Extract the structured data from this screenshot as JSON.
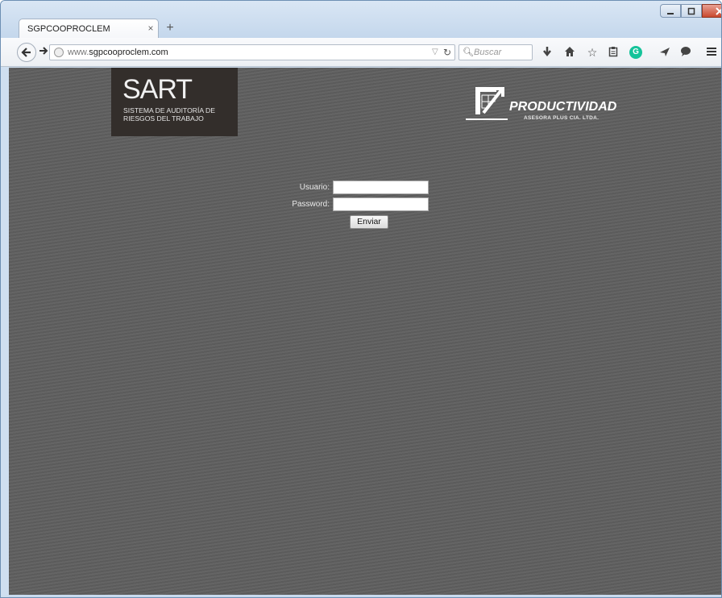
{
  "browser": {
    "tab_title": "SGPCOOPROCLEM",
    "tab_close": "×",
    "new_tab": "+",
    "url_prefix": "www.",
    "url_domain": "sgpcooproclem.com",
    "search_placeholder": "Buscar",
    "icons": {
      "back": "back-arrow-icon",
      "forward": "forward-arrow-icon",
      "globe": "globe-icon",
      "reload": "reload-icon",
      "search": "search-icon",
      "download": "download-icon",
      "home": "home-icon",
      "bookmark": "star-icon",
      "reading_list": "clipboard-icon",
      "grammarly": "grammarly-icon",
      "send": "send-icon",
      "chat": "chat-icon",
      "menu": "hamburger-menu-icon"
    },
    "window_controls": [
      "minimize",
      "maximize",
      "close"
    ]
  },
  "page": {
    "background_color": "#5f5f5f",
    "sart_logo": {
      "title": "SART",
      "subtitle_line1": "SISTEMA DE AUDITORÍA DE",
      "subtitle_line2": "RIESGOS DEL TRABAJO",
      "background_color": "#332e2b"
    },
    "productividad_logo": {
      "title": "PRODUCTIVIDAD",
      "subtitle": "ASESORA PLUS CIA. LTDA."
    },
    "login_form": {
      "username_label": "Usuario:",
      "password_label": "Password:",
      "username_value": "",
      "password_value": "",
      "submit_label": "Enviar"
    }
  }
}
